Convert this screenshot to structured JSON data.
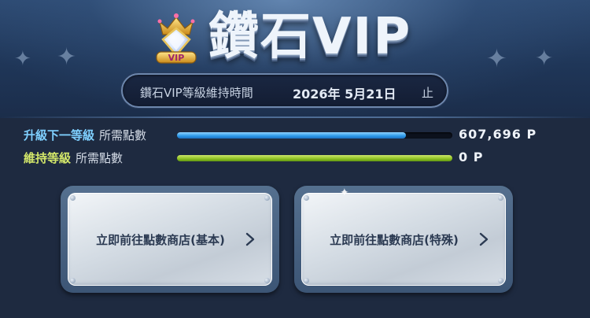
{
  "header": {
    "title": "鑽石VIP",
    "badge_text": "VIP"
  },
  "maintenance": {
    "label": "鑽石VIP等級維持時間",
    "date": "2026年 5月21日",
    "suffix": "止"
  },
  "progress": [
    {
      "highlight": "升級下一等級",
      "requirement": "所需點數",
      "points": "607,696 P",
      "fill_percent": 83,
      "highlight_color": "#7fd0ff"
    },
    {
      "highlight": "維持等級",
      "requirement": "所需點數",
      "points": "0 P",
      "fill_percent": 100,
      "highlight_color": "#d4e86a"
    }
  ],
  "buttons": [
    {
      "label": "立即前往點數商店(基本)"
    },
    {
      "label": "立即前往點數商店(特殊)"
    }
  ],
  "colors": {
    "background": "#1e2a40",
    "bar_blue": "#2c98e8",
    "bar_green": "#8fc224"
  }
}
